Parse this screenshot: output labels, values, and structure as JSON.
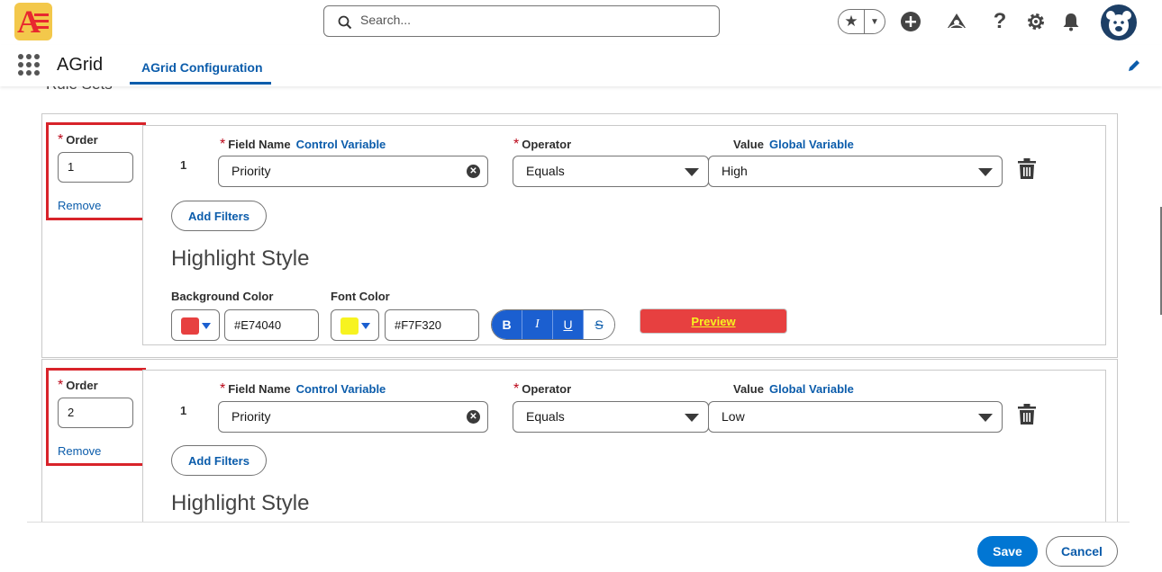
{
  "header": {
    "search_placeholder": "Search...",
    "app_name": "AGrid",
    "active_tab": "AGrid Configuration"
  },
  "section": {
    "title": "Rule Sets"
  },
  "labels": {
    "order": "Order",
    "remove": "Remove",
    "field_name": "Field Name",
    "control_variable": "Control Variable",
    "operator": "Operator",
    "value": "Value",
    "global_variable": "Global Variable",
    "add_filters": "Add Filters",
    "highlight_style": "Highlight Style",
    "background_color": "Background Color",
    "font_color": "Font Color",
    "preview": "Preview"
  },
  "rules": [
    {
      "order": "1",
      "filter_index": "1",
      "field": "Priority",
      "operator": "Equals",
      "value": "High",
      "background_hex": "#E74040",
      "font_hex": "#F7F320",
      "background_color": "#e74040",
      "font_color": "#f7f320"
    },
    {
      "order": "2",
      "filter_index": "1",
      "field": "Priority",
      "operator": "Equals",
      "value": "Low"
    }
  ],
  "format_buttons": {
    "bold": "B",
    "italic": "I",
    "underline": "U",
    "strike": "S"
  },
  "footer": {
    "save": "Save",
    "cancel": "Cancel"
  },
  "icons": [
    "search-icon",
    "star-icon",
    "chevron-down-icon",
    "add-icon",
    "trailhead-icon",
    "help-icon",
    "setup-gear-icon",
    "bell-icon",
    "avatar",
    "app-launcher-icon",
    "edit-pencil-icon",
    "clear-icon",
    "trash-icon"
  ]
}
